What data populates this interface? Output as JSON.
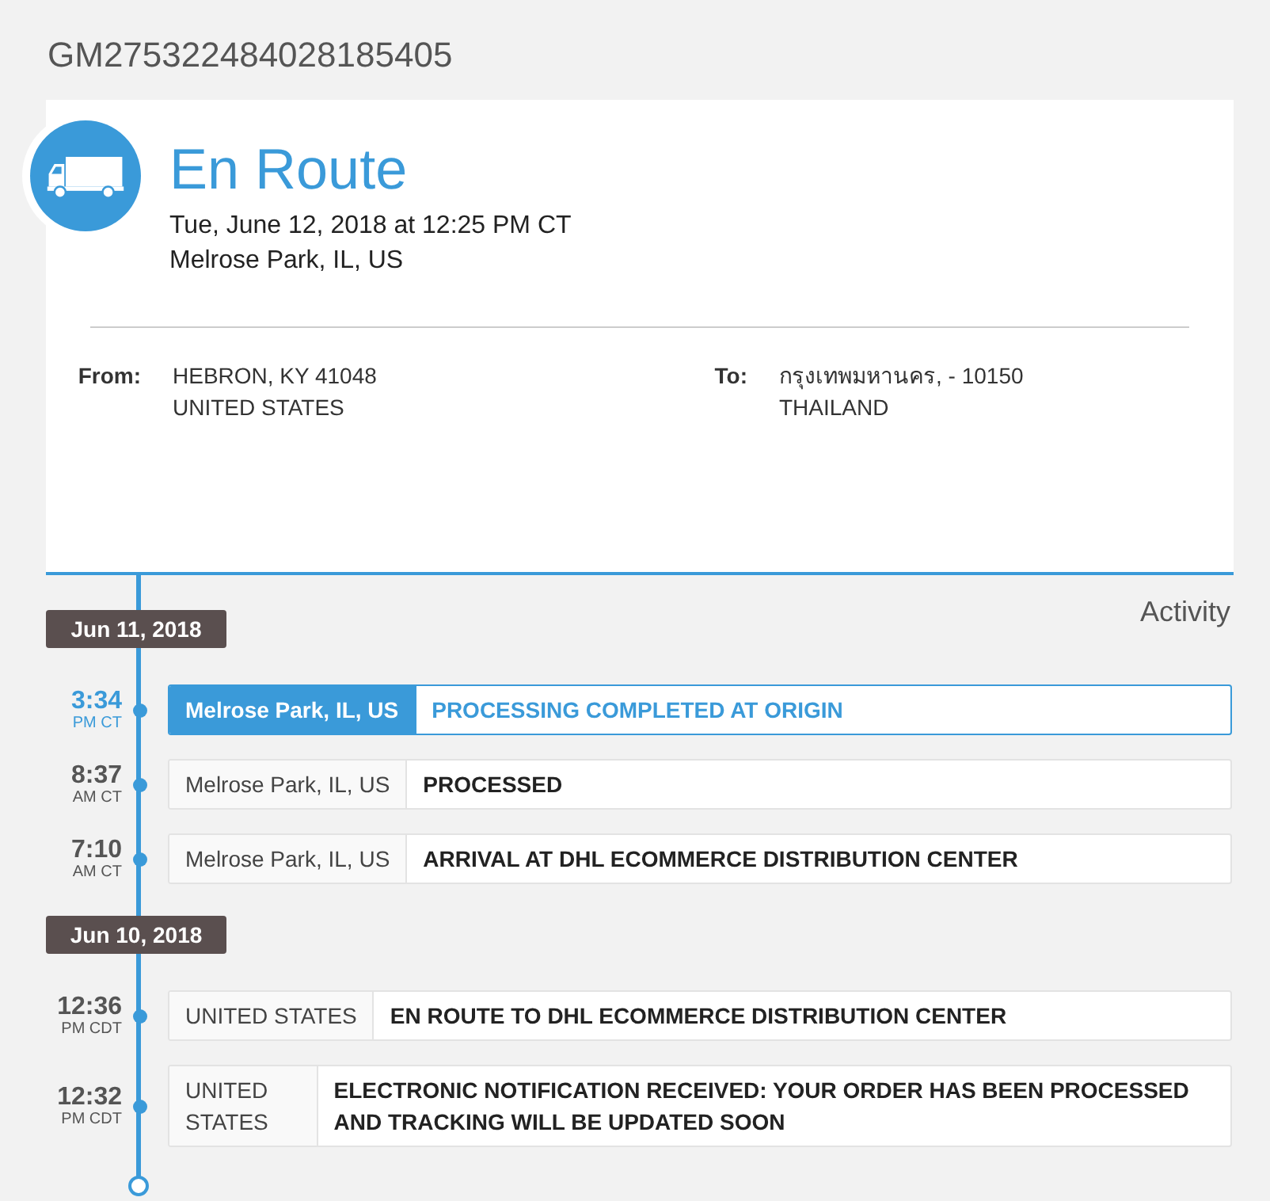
{
  "tracking_number": "GM275322484028185405",
  "status": {
    "title": "En Route",
    "datetime": "Tue, June 12, 2018 at 12:25 PM CT",
    "location": "Melrose Park, IL, US"
  },
  "from": {
    "label": "From:",
    "lines": [
      "HEBRON, KY 41048",
      "UNITED STATES"
    ]
  },
  "to": {
    "label": "To:",
    "lines": [
      "กรุงเทพมหานคร, - 10150",
      "THAILAND"
    ]
  },
  "activity_heading": "Activity",
  "groups": [
    {
      "date": "Jun 11, 2018",
      "events": [
        {
          "time": "3:34",
          "zone": "PM CT",
          "location": "Melrose Park, IL, US",
          "description": "PROCESSING COMPLETED AT ORIGIN",
          "selected": true
        },
        {
          "time": "8:37",
          "zone": "AM CT",
          "location": "Melrose Park, IL, US",
          "description": "PROCESSED",
          "selected": false
        },
        {
          "time": "7:10",
          "zone": "AM CT",
          "location": "Melrose Park, IL, US",
          "description": "ARRIVAL AT DHL ECOMMERCE DISTRIBUTION CENTER",
          "selected": false
        }
      ]
    },
    {
      "date": "Jun 10, 2018",
      "events": [
        {
          "time": "12:36",
          "zone": "PM CDT",
          "location": "UNITED STATES",
          "description": "EN ROUTE TO DHL ECOMMERCE DISTRIBUTION CENTER",
          "selected": false
        },
        {
          "time": "12:32",
          "zone": "PM CDT",
          "location": "UNITED STATES",
          "description": "ELECTRONIC NOTIFICATION RECEIVED: YOUR ORDER HAS BEEN PROCESSED AND TRACKING WILL BE UPDATED SOON",
          "selected": false
        }
      ]
    }
  ]
}
